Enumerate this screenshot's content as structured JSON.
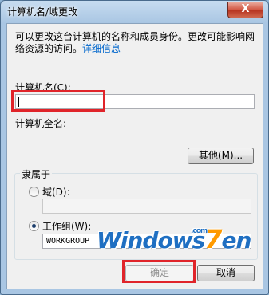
{
  "window": {
    "title": "计算机名/域更改",
    "close_label": "X"
  },
  "description": {
    "text": "可以更改这台计算机的名称和成员身份。更改可能影响网络资源的访问。",
    "link": "详细信息"
  },
  "computer_name": {
    "label": "计算机名(C):",
    "value": ""
  },
  "full_computer_name": {
    "label": "计算机全名:"
  },
  "buttons": {
    "more": "其他(M)...",
    "ok": "确定",
    "cancel": "取消"
  },
  "member_of": {
    "group_label": "隶属于",
    "domain_label": "域(D):",
    "domain_value": "",
    "workgroup_label": "工作组(W):",
    "workgroup_value": "WORKGROUP",
    "selected": "workgroup"
  },
  "watermark": {
    "text_main": "Windows",
    "text_seven": "7",
    "text_end": "en",
    "text_com": ".com"
  },
  "colors": {
    "highlight_box": "#e0242a",
    "link": "#0066cc"
  }
}
